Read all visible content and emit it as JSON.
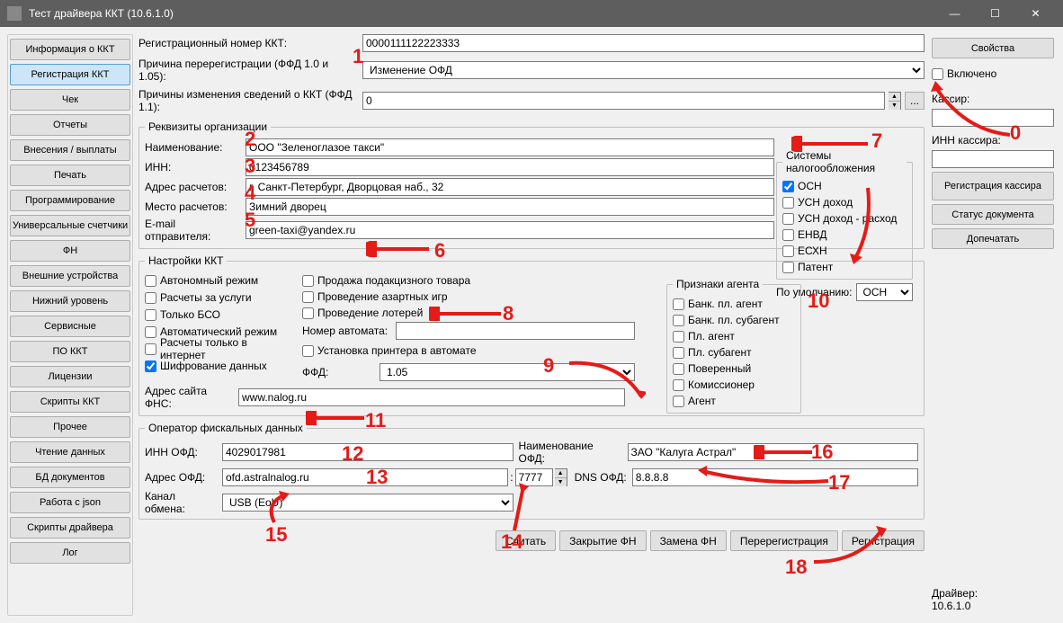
{
  "window": {
    "title": "Тест драйвера ККТ (10.6.1.0)"
  },
  "leftnav": {
    "items": [
      "Информация о ККТ",
      "Регистрация ККТ",
      "Чек",
      "Отчеты",
      "Внесения / выплаты",
      "Печать",
      "Программирование",
      "Универсальные счетчики",
      "ФН",
      "Внешние устройства",
      "Нижний уровень",
      "Сервисные",
      "ПО ККТ",
      "Лицензии",
      "Скрипты ККТ",
      "Прочее",
      "Чтение данных",
      "БД документов",
      "Работа с json",
      "Скрипты драйвера",
      "Лог"
    ],
    "active_index": 1
  },
  "top": {
    "reg_number_label": "Регистрационный номер ККТ:",
    "reg_number": "0000111122223333",
    "rereg_reason_label": "Причина перерегистрации (ФФД 1.0 и 1.05):",
    "rereg_reason": "Изменение ОФД",
    "change_info_label": "Причины изменения сведений о ККТ (ФФД 1.1):",
    "change_info": "0"
  },
  "org": {
    "legend": "Реквизиты организации",
    "name_label": "Наименование:",
    "name": "ООО \"Зеленоглазое такси\"",
    "inn_label": "ИНН:",
    "inn": "0123456789",
    "calc_addr_label": "Адрес расчетов:",
    "calc_addr": "г. Санкт-Петербург, Дворцовая наб., 32",
    "calc_place_label": "Место расчетов:",
    "calc_place": "Зимний дворец",
    "email_label": "E-mail отправителя:",
    "email": "green-taxi@yandex.ru"
  },
  "tax": {
    "legend": "Системы налогообложения",
    "items": [
      "ОСН",
      "УСН доход",
      "УСН доход - расход",
      "ЕНВД",
      "ЕСХН",
      "Патент"
    ],
    "checked": [
      true,
      false,
      false,
      false,
      false,
      false
    ],
    "default_label": "По умолчанию:",
    "default": "ОСН"
  },
  "kkt_settings": {
    "legend": "Настройки ККТ",
    "col1": [
      "Автономный режим",
      "Расчеты за услуги",
      "Только БСО",
      "Автоматический режим",
      "Расчеты только в интернет",
      "Шифрование данных"
    ],
    "col1_checked": [
      false,
      false,
      false,
      false,
      false,
      true
    ],
    "col2": [
      "Продажа подакцизного товара",
      "Проведение азартных игр",
      "Проведение лотерей"
    ],
    "auto_num_label": "Номер автомата:",
    "printer_label": "Установка принтера в автомате",
    "ffd_label": "ФФД:",
    "ffd": "1.05",
    "fns_label": "Адрес сайта ФНС:",
    "fns": "www.nalog.ru"
  },
  "agent": {
    "legend": "Признаки агента",
    "items": [
      "Банк. пл. агент",
      "Банк. пл. субагент",
      "Пл. агент",
      "Пл. субагент",
      "Поверенный",
      "Комиссионер",
      "Агент"
    ]
  },
  "ofd": {
    "legend": "Оператор фискальных данных",
    "inn_label": "ИНН ОФД:",
    "inn": "4029017981",
    "name_label": "Наименование ОФД:",
    "name": "ЗАО \"Калуга Астрал\"",
    "addr_label": "Адрес ОФД:",
    "addr": "ofd.astralnalog.ru",
    "port": "7777",
    "dns_label": "DNS ОФД:",
    "dns": "8.8.8.8",
    "channel_label": "Канал обмена:",
    "channel": "USB (EoU)"
  },
  "actions": {
    "read": "Считать",
    "close_fn": "Закрытие ФН",
    "replace_fn": "Замена ФН",
    "rereg": "Перерегистрация",
    "reg": "Регистрация"
  },
  "right": {
    "props": "Свойства",
    "enabled": "Включено",
    "cashier_label": "Кассир:",
    "cashier_inn_label": "ИНН кассира:",
    "reg_cashier": "Регистрация кассира",
    "doc_status": "Статус документа",
    "reprint": "Допечатать",
    "driver_label": "Драйвер:",
    "driver_ver": "10.6.1.0"
  },
  "annotations": [
    "0",
    "1",
    "2",
    "3",
    "4",
    "5",
    "6",
    "7",
    "8",
    "9",
    "10",
    "11",
    "12",
    "13",
    "14",
    "15",
    "16",
    "17",
    "18"
  ]
}
